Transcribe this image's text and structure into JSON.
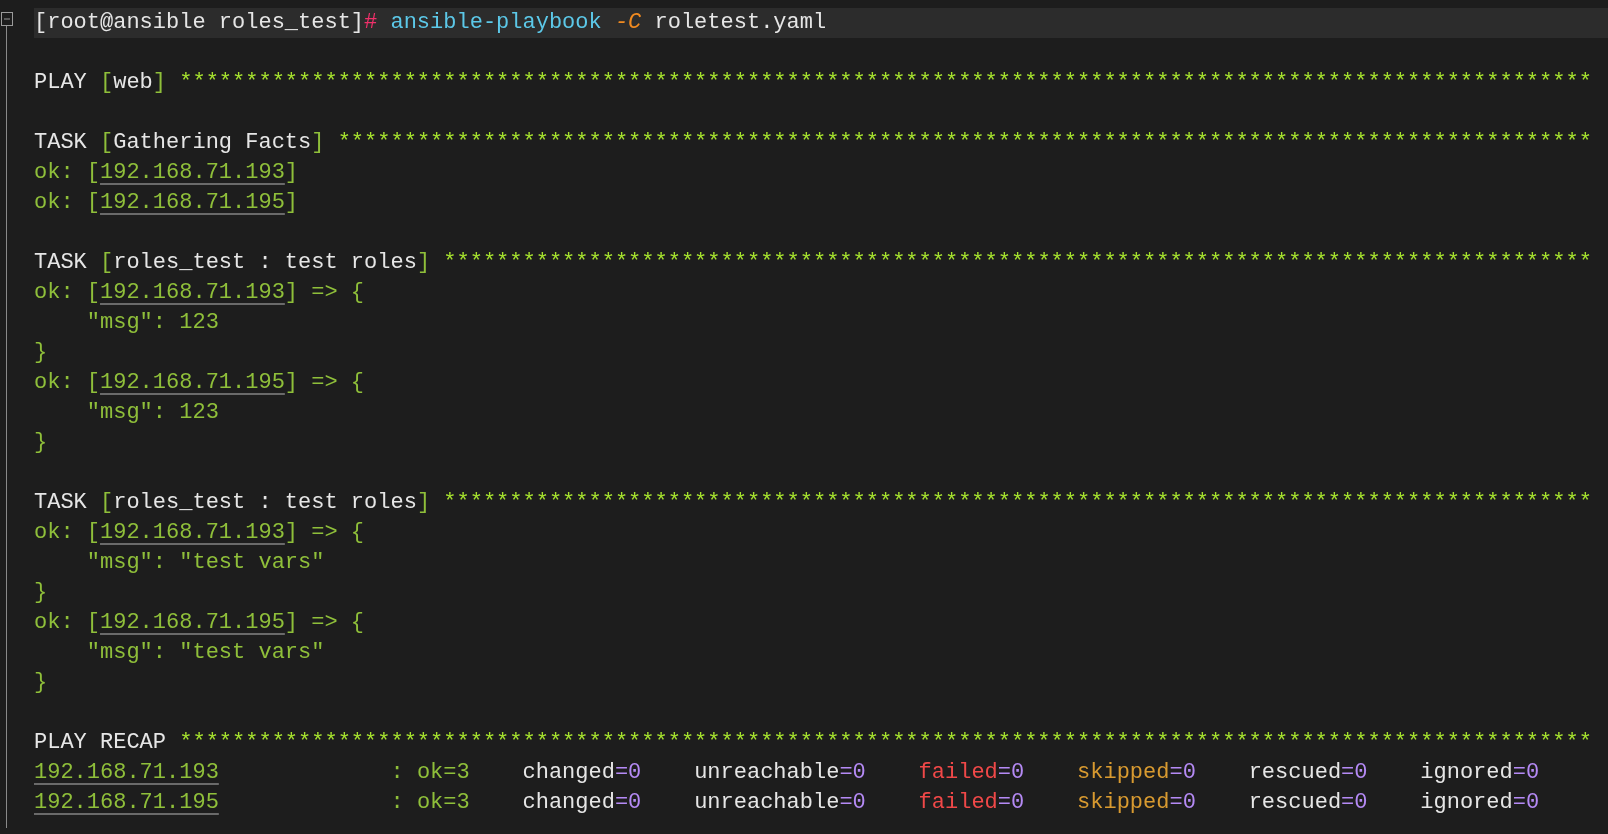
{
  "terminal": {
    "blocks": [
      {
        "lines": [
          {
            "current": true,
            "segments": [
              {
                "text": "[root@ansible roles_test]",
                "kind": "plain"
              },
              {
                "text": "#",
                "kind": "hash"
              },
              {
                "text": " ansible-playbook",
                "kind": "command"
              },
              {
                "text": " -C",
                "kind": "flag"
              },
              {
                "text": " roletest.yaml",
                "kind": "plain"
              }
            ]
          }
        ]
      },
      {
        "lines": [
          {
            "current": false,
            "segments": [
              {
                "text": "PLAY ",
                "kind": "plain"
              },
              {
                "text": "[",
                "kind": "green"
              },
              {
                "text": "web",
                "kind": "plain"
              },
              {
                "text": "]",
                "kind": "green"
              },
              {
                "text": " ***********************************************************************************************************",
                "kind": "stars"
              }
            ]
          }
        ]
      },
      {
        "lines": [
          {
            "current": false,
            "segments": [
              {
                "text": "TASK ",
                "kind": "plain"
              },
              {
                "text": "[",
                "kind": "green"
              },
              {
                "text": "Gathering Facts",
                "kind": "plain"
              },
              {
                "text": "]",
                "kind": "green"
              },
              {
                "text": " ***********************************************************************************************",
                "kind": "stars"
              }
            ]
          },
          {
            "current": false,
            "segments": [
              {
                "text": "ok: [",
                "kind": "green"
              },
              {
                "text": "192.168.71.193",
                "kind": "link"
              },
              {
                "text": "]",
                "kind": "green"
              }
            ]
          },
          {
            "current": false,
            "segments": [
              {
                "text": "ok: [",
                "kind": "green"
              },
              {
                "text": "192.168.71.195",
                "kind": "link"
              },
              {
                "text": "]",
                "kind": "green"
              }
            ]
          }
        ]
      },
      {
        "lines": [
          {
            "current": false,
            "segments": [
              {
                "text": "TASK ",
                "kind": "plain"
              },
              {
                "text": "[",
                "kind": "green"
              },
              {
                "text": "roles_test : test roles",
                "kind": "plain"
              },
              {
                "text": "]",
                "kind": "green"
              },
              {
                "text": " ***************************************************************************************",
                "kind": "stars"
              }
            ]
          },
          {
            "current": false,
            "segments": [
              {
                "text": "ok: [",
                "kind": "green"
              },
              {
                "text": "192.168.71.193",
                "kind": "link"
              },
              {
                "text": "] => {",
                "kind": "green"
              }
            ]
          },
          {
            "current": false,
            "segments": [
              {
                "text": "    \"msg\": 123",
                "kind": "green"
              }
            ]
          },
          {
            "current": false,
            "segments": [
              {
                "text": "}",
                "kind": "green"
              }
            ]
          },
          {
            "current": false,
            "segments": [
              {
                "text": "ok: [",
                "kind": "green"
              },
              {
                "text": "192.168.71.195",
                "kind": "link"
              },
              {
                "text": "] => {",
                "kind": "green"
              }
            ]
          },
          {
            "current": false,
            "segments": [
              {
                "text": "    \"msg\": 123",
                "kind": "green"
              }
            ]
          },
          {
            "current": false,
            "segments": [
              {
                "text": "}",
                "kind": "green"
              }
            ]
          }
        ]
      },
      {
        "lines": [
          {
            "current": false,
            "segments": [
              {
                "text": "TASK ",
                "kind": "plain"
              },
              {
                "text": "[",
                "kind": "green"
              },
              {
                "text": "roles_test : test roles",
                "kind": "plain"
              },
              {
                "text": "]",
                "kind": "green"
              },
              {
                "text": " ***************************************************************************************",
                "kind": "stars"
              }
            ]
          },
          {
            "current": false,
            "segments": [
              {
                "text": "ok: [",
                "kind": "green"
              },
              {
                "text": "192.168.71.193",
                "kind": "link"
              },
              {
                "text": "] => {",
                "kind": "green"
              }
            ]
          },
          {
            "current": false,
            "segments": [
              {
                "text": "    \"msg\": \"test vars\"",
                "kind": "green"
              }
            ]
          },
          {
            "current": false,
            "segments": [
              {
                "text": "}",
                "kind": "green"
              }
            ]
          },
          {
            "current": false,
            "segments": [
              {
                "text": "ok: [",
                "kind": "green"
              },
              {
                "text": "192.168.71.195",
                "kind": "link"
              },
              {
                "text": "] => {",
                "kind": "green"
              }
            ]
          },
          {
            "current": false,
            "segments": [
              {
                "text": "    \"msg\": \"test vars\"",
                "kind": "green"
              }
            ]
          },
          {
            "current": false,
            "segments": [
              {
                "text": "}",
                "kind": "green"
              }
            ]
          }
        ]
      },
      {
        "lines": [
          {
            "current": false,
            "segments": [
              {
                "text": "PLAY RECAP",
                "kind": "plain"
              },
              {
                "text": " ***********************************************************************************************************",
                "kind": "stars"
              }
            ]
          },
          {
            "current": false,
            "segments": [
              {
                "text": "192.168.71.193",
                "kind": "link"
              },
              {
                "text": "             : ok=3",
                "kind": "green"
              },
              {
                "text": "    changed",
                "kind": "plain"
              },
              {
                "text": "=0",
                "kind": "purple"
              },
              {
                "text": "    unreachable",
                "kind": "plain"
              },
              {
                "text": "=0",
                "kind": "purple"
              },
              {
                "text": "    failed",
                "kind": "red"
              },
              {
                "text": "=0",
                "kind": "purple"
              },
              {
                "text": "    skipped",
                "kind": "orange"
              },
              {
                "text": "=0",
                "kind": "purple"
              },
              {
                "text": "    rescued",
                "kind": "plain"
              },
              {
                "text": "=0",
                "kind": "purple"
              },
              {
                "text": "    ignored",
                "kind": "plain"
              },
              {
                "text": "=0",
                "kind": "purple"
              }
            ]
          },
          {
            "current": false,
            "segments": [
              {
                "text": "192.168.71.195",
                "kind": "link"
              },
              {
                "text": "             : ok=3",
                "kind": "green"
              },
              {
                "text": "    changed",
                "kind": "plain"
              },
              {
                "text": "=0",
                "kind": "purple"
              },
              {
                "text": "    unreachable",
                "kind": "plain"
              },
              {
                "text": "=0",
                "kind": "purple"
              },
              {
                "text": "    failed",
                "kind": "red"
              },
              {
                "text": "=0",
                "kind": "purple"
              },
              {
                "text": "    skipped",
                "kind": "orange"
              },
              {
                "text": "=0",
                "kind": "purple"
              },
              {
                "text": "    rescued",
                "kind": "plain"
              },
              {
                "text": "=0",
                "kind": "purple"
              },
              {
                "text": "    ignored",
                "kind": "plain"
              },
              {
                "text": "=0",
                "kind": "purple"
              }
            ]
          }
        ]
      }
    ]
  }
}
